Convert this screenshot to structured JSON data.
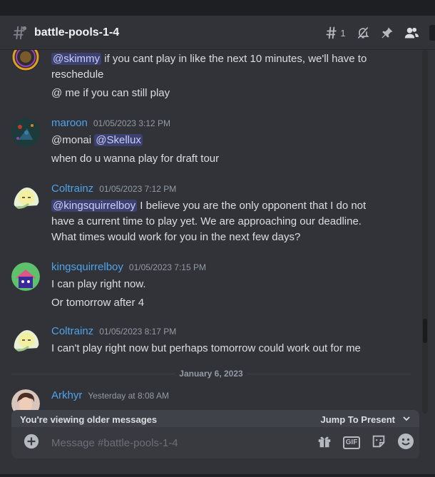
{
  "colors": {
    "background": "#313338",
    "mention_bg": "#4a4f84",
    "username_blue": "#4ea4ea",
    "timestamp": "#949ba4"
  },
  "channel": {
    "icon": "hash-threads-icon",
    "name": "battle-pools-1-4",
    "thread_count": "1"
  },
  "toolbar": {
    "threads_icon": "threads-icon",
    "mute_icon": "mute-bell-icon",
    "pins_icon": "pin-icon",
    "members_icon": "members-icon"
  },
  "messages": [
    {
      "user": "",
      "timestamp": "",
      "mention": "@skimmy",
      "text1_rest": " if you cant play in like the next 10 minutes, we'll have to",
      "text1_cont": "reschedule",
      "text2": "@ me if you can still play"
    },
    {
      "user": "maroon",
      "timestamp": "01/05/2023 3:12 PM",
      "line1_prefix": "@monai ",
      "line1_mention": "@Skellux",
      "line2": "when do u wanna play for draft tour"
    },
    {
      "user": "Coltrainz",
      "timestamp": "01/05/2023 7:12 PM",
      "mention": "@kingsquirrelboy",
      "line1_rest": " I believe you are the only opponent that I do not",
      "line2": "have a current time to play yet. We are approaching our deadline.",
      "line3": "What times would work for you in the next few days?"
    },
    {
      "user": "kingsquirrelboy",
      "timestamp": "01/05/2023 7:15 PM",
      "line1": "I can play right now.",
      "line2": "Or tomorrow after 4"
    },
    {
      "user": "Coltrainz",
      "timestamp": "01/05/2023 8:17 PM",
      "line1": "I can't play right now but perhaps tomorrow could work out for me"
    },
    {
      "user": "Arkhyr",
      "timestamp": "Yesterday at 8:08 AM"
    }
  ],
  "date_divider": "January 6, 2023",
  "older_bar": {
    "label": "You're viewing older messages",
    "jump": "Jump To Present"
  },
  "composer": {
    "placeholder": "Message #battle-pools-1-4",
    "gif_label": "GIF"
  }
}
